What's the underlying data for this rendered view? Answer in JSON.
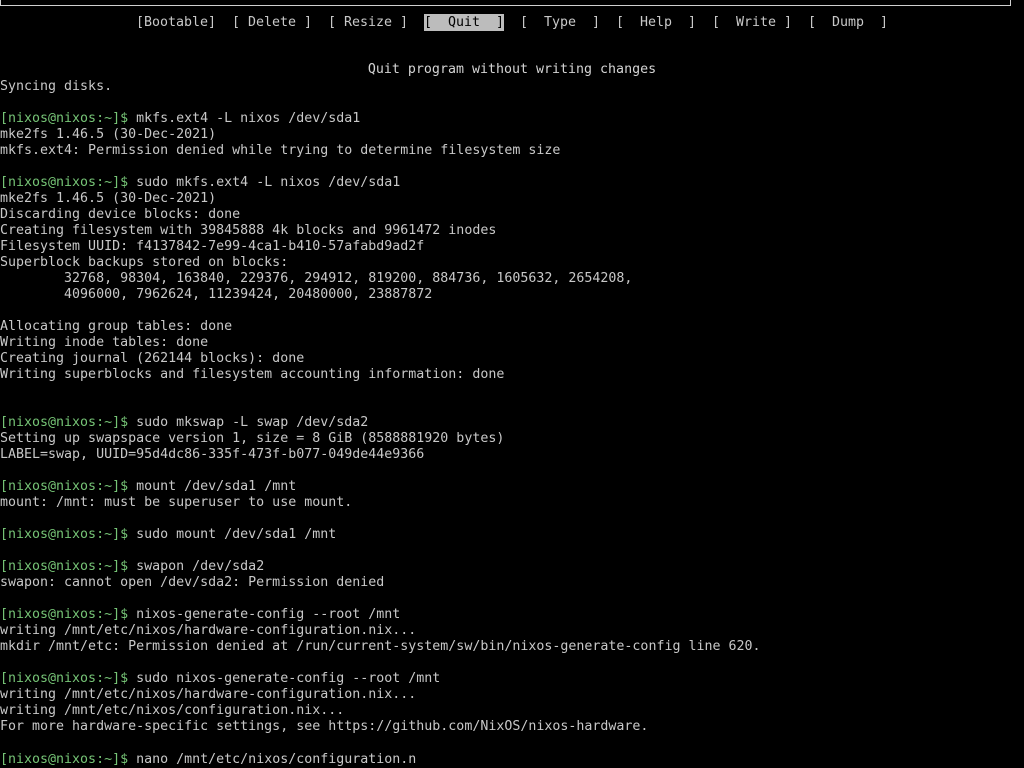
{
  "menu": {
    "buttons": [
      {
        "label": "[Bootable]",
        "selected": false
      },
      {
        "label": "[ Delete ]",
        "selected": false
      },
      {
        "label": "[ Resize ]",
        "selected": false
      },
      {
        "label": "[  Quit  ]",
        "selected": true
      },
      {
        "label": "[  Type  ]",
        "selected": false
      },
      {
        "label": "[  Help  ]",
        "selected": false
      },
      {
        "label": "[  Write ]",
        "selected": false
      },
      {
        "label": "[  Dump  ]",
        "selected": false
      }
    ],
    "description": "Quit program without writing changes"
  },
  "terminal": {
    "prompt": "[nixos@nixos:~]$",
    "lines": [
      {
        "type": "out",
        "text": "Syncing disks."
      },
      {
        "type": "blank"
      },
      {
        "type": "cmd",
        "text": "mkfs.ext4 -L nixos /dev/sda1"
      },
      {
        "type": "out",
        "text": "mke2fs 1.46.5 (30-Dec-2021)"
      },
      {
        "type": "out",
        "text": "mkfs.ext4: Permission denied while trying to determine filesystem size"
      },
      {
        "type": "blank"
      },
      {
        "type": "cmd",
        "text": "sudo mkfs.ext4 -L nixos /dev/sda1"
      },
      {
        "type": "out",
        "text": "mke2fs 1.46.5 (30-Dec-2021)"
      },
      {
        "type": "out",
        "text": "Discarding device blocks: done"
      },
      {
        "type": "out",
        "text": "Creating filesystem with 39845888 4k blocks and 9961472 inodes"
      },
      {
        "type": "out",
        "text": "Filesystem UUID: f4137842-7e99-4ca1-b410-57afabd9ad2f"
      },
      {
        "type": "out",
        "text": "Superblock backups stored on blocks:"
      },
      {
        "type": "out",
        "text": "        32768, 98304, 163840, 229376, 294912, 819200, 884736, 1605632, 2654208,"
      },
      {
        "type": "out",
        "text": "        4096000, 7962624, 11239424, 20480000, 23887872"
      },
      {
        "type": "blank"
      },
      {
        "type": "out",
        "text": "Allocating group tables: done"
      },
      {
        "type": "out",
        "text": "Writing inode tables: done"
      },
      {
        "type": "out",
        "text": "Creating journal (262144 blocks): done"
      },
      {
        "type": "out",
        "text": "Writing superblocks and filesystem accounting information: done"
      },
      {
        "type": "blank"
      },
      {
        "type": "blank"
      },
      {
        "type": "cmd",
        "text": "sudo mkswap -L swap /dev/sda2"
      },
      {
        "type": "out",
        "text": "Setting up swapspace version 1, size = 8 GiB (8588881920 bytes)"
      },
      {
        "type": "out",
        "text": "LABEL=swap, UUID=95d4dc86-335f-473f-b077-049de44e9366"
      },
      {
        "type": "blank"
      },
      {
        "type": "cmd",
        "text": "mount /dev/sda1 /mnt"
      },
      {
        "type": "out",
        "text": "mount: /mnt: must be superuser to use mount."
      },
      {
        "type": "blank"
      },
      {
        "type": "cmd",
        "text": "sudo mount /dev/sda1 /mnt"
      },
      {
        "type": "blank"
      },
      {
        "type": "cmd",
        "text": "swapon /dev/sda2"
      },
      {
        "type": "out",
        "text": "swapon: cannot open /dev/sda2: Permission denied"
      },
      {
        "type": "blank"
      },
      {
        "type": "cmd",
        "text": "nixos-generate-config --root /mnt"
      },
      {
        "type": "out",
        "text": "writing /mnt/etc/nixos/hardware-configuration.nix..."
      },
      {
        "type": "out",
        "text": "mkdir /mnt/etc: Permission denied at /run/current-system/sw/bin/nixos-generate-config line 620."
      },
      {
        "type": "blank"
      },
      {
        "type": "cmd",
        "text": "sudo nixos-generate-config --root /mnt"
      },
      {
        "type": "out",
        "text": "writing /mnt/etc/nixos/hardware-configuration.nix..."
      },
      {
        "type": "out",
        "text": "writing /mnt/etc/nixos/configuration.nix..."
      },
      {
        "type": "out",
        "text": "For more hardware-specific settings, see https://github.com/NixOS/nixos-hardware."
      },
      {
        "type": "blank"
      },
      {
        "type": "cmd",
        "text": "nano /mnt/etc/nixos/configuration.n"
      }
    ]
  },
  "colors": {
    "background": "#000000",
    "text": "#c8c8c8",
    "prompt": "#76c476",
    "selected_bg": "#bcbcbc",
    "selected_fg": "#000000"
  }
}
